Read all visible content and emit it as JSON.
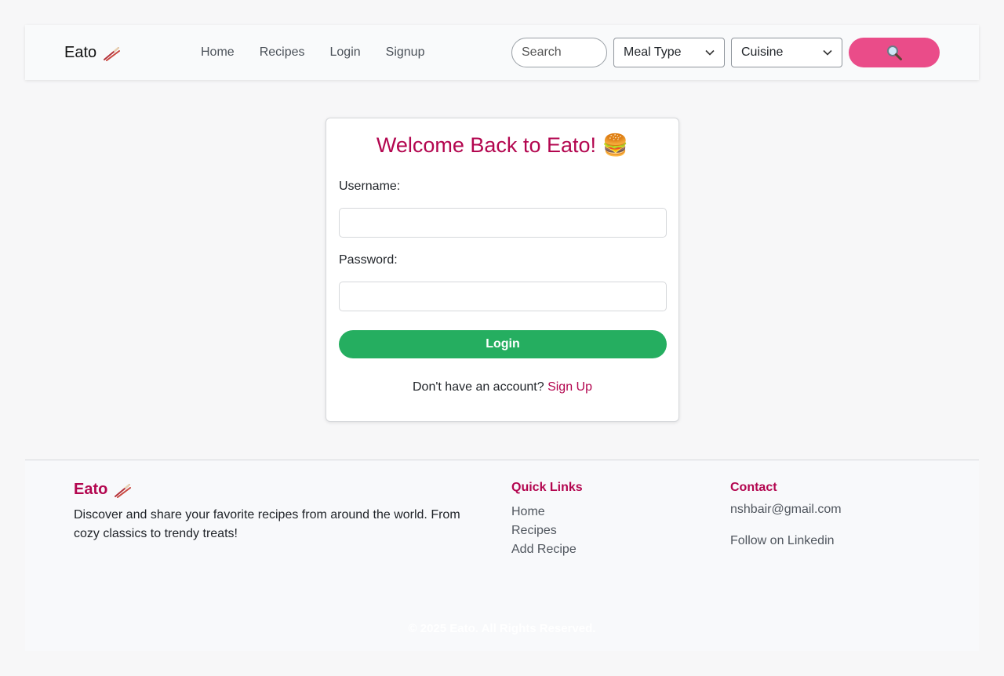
{
  "navbar": {
    "brand": "Eato",
    "links": [
      "Home",
      "Recipes",
      "Login",
      "Signup"
    ],
    "search_placeholder": "Search",
    "meal_type": "Meal Type",
    "cuisine": "Cuisine",
    "search_button_icon": "magnifier-icon"
  },
  "login": {
    "title": "Welcome Back to Eato! 🍔",
    "username_label": "Username:",
    "password_label": "Password:",
    "login_button": "Login",
    "no_account_text": "Don't have an account?",
    "signup_link": "Sign Up"
  },
  "footer": {
    "brand": "Eato",
    "description": "Discover and share your favorite recipes from around the world. From cozy classics to trendy treats!",
    "quick_links_heading": "Quick Links",
    "quick_links": [
      "Home",
      "Recipes",
      "Add Recipe"
    ],
    "contact_heading": "Contact",
    "email": "nshbair@gmail.com",
    "linkedin": "Follow on Linkedin",
    "copyright": "© 2025 Eato. All Rights Reserved."
  },
  "colors": {
    "accent": "#b3064f",
    "search_button": "#ea4c89",
    "login_button": "#25ae60"
  }
}
